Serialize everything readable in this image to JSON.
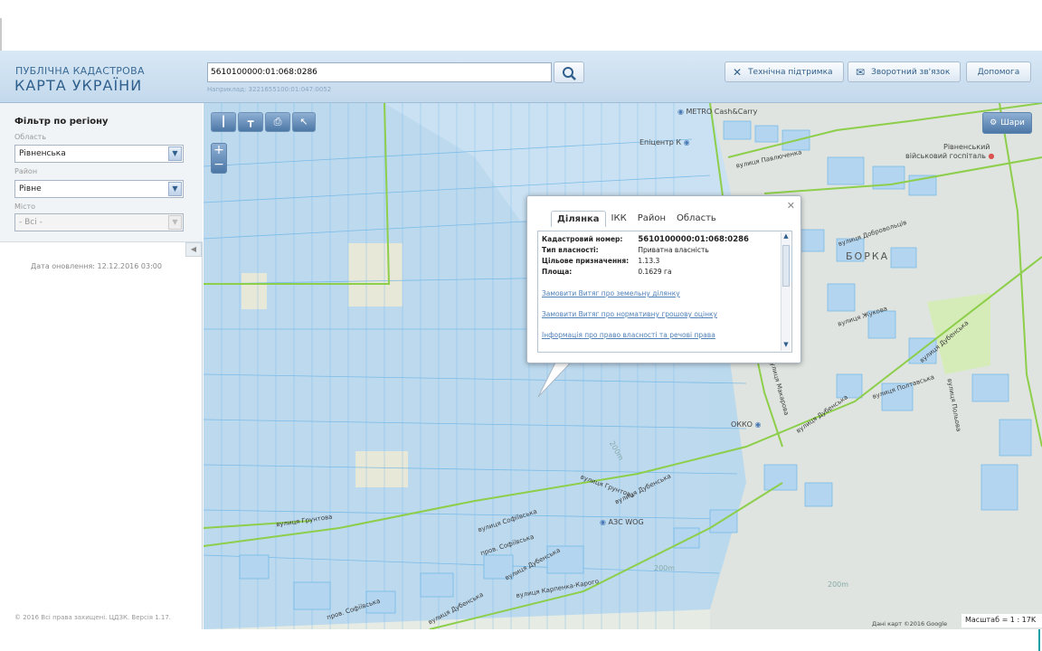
{
  "header": {
    "logo_top": "ПУБЛІЧНА КАДАСТРОВА",
    "logo_bottom": "КАРТА УКРАЇНИ",
    "search_value": "5610100000:01:068:0286",
    "search_hint": "Наприклад: 3221655100:01:047:0052",
    "buttons": {
      "support": "Технічна підтримка",
      "feedback": "Зворотний зв'язок",
      "help": "Допомога"
    }
  },
  "sidebar": {
    "filter_title": "Фільтр по регіону",
    "region_label": "Область",
    "region_value": "Рівненська",
    "district_label": "Район",
    "district_value": "Рівне",
    "city_label": "Місто",
    "city_value": "- Всі -",
    "update_date": "Дата оновлення: 12.12.2016 03:00",
    "copyright": "© 2016 Всі права захищені. ЦДЗК. Версія 1.17."
  },
  "map": {
    "layers_button": "Шари",
    "places": {
      "metro": "METRO Cash&Carry",
      "epicentr": "Епіцентр К",
      "hospital_line1": "Рівненський",
      "hospital_line2": "військовий госпіталь",
      "borka": "БОРКА",
      "okko": "ОККО",
      "wog": "АЗС WOG"
    },
    "streets": {
      "pavlyuchenka": "вулиця Павлюченка",
      "dobrovolcha": "вулиця Добровольців",
      "zhukova": "вулиця Жукова",
      "makarova": "вулиця Макарова",
      "dubenska1": "вулиця Дубенська",
      "dubenska2": "вулиця Дубенська",
      "dubenska3": "вулиця Дубенська",
      "dubenska4": "вулиця Дубенська",
      "dubenska5": "вулиця Дубенська",
      "poltavska": "вулиця Полтавська",
      "poliova": "вулиця Польова",
      "gruntova1": "вулиця Грунтова",
      "gruntova2": "вулиця Грунтова",
      "sofiivska": "вулиця Софіївська",
      "sofiivska_lane1": "пров. Софіївська",
      "sofiivska_lane2": "пров. Софіївська",
      "karpenka": "вулиця Карпенка-Карого",
      "contour1": "200m",
      "contour2": "200m",
      "contour3": "200m"
    },
    "scale": "Масштаб = 1 : 17K",
    "attribution": "Дані карт ©2016 Google"
  },
  "popup": {
    "tabs": [
      "Ділянка",
      "ІКК",
      "Район",
      "Область"
    ],
    "rows": [
      {
        "key": "Кадастровий номер:",
        "value": "5610100000:01:068:0286"
      },
      {
        "key": "Тип власності:",
        "value": "Приватна власність"
      },
      {
        "key": "Цільове призначення:",
        "value": "1.13.3"
      },
      {
        "key": "Площа:",
        "value": "0.1629 га"
      }
    ],
    "links": [
      "Замовити Витяг про земельну ділянку",
      "Замовити Витяг про нормативну грошову оцінку",
      "Інформація про право власності та речові права"
    ]
  },
  "colors": {
    "map_bg": "#e6ebe4",
    "parcel_fill": "#b3d5ef",
    "parcel_stroke": "#5fb0e5",
    "boundary_green": "#8dce4a",
    "header_blue": "#2f5f8c"
  }
}
